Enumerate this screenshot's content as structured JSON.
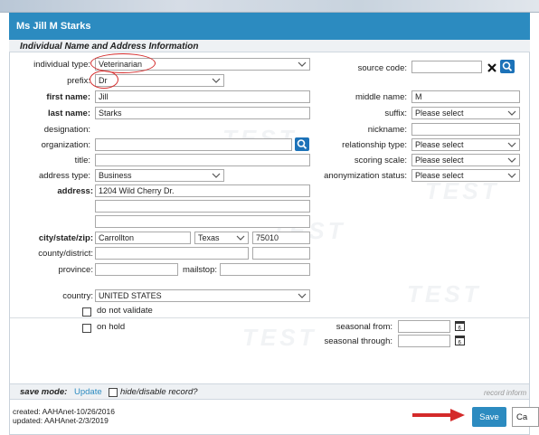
{
  "header": {
    "title": "Ms Jill M Starks"
  },
  "section": {
    "title": "Individual Name and Address Information"
  },
  "labels": {
    "individual_type": "individual type:",
    "prefix": "prefix:",
    "first_name": "first name:",
    "last_name": "last name:",
    "designation": "designation:",
    "organization": "organization:",
    "title": "title:",
    "address_type": "address type:",
    "address": "address:",
    "city_state_zip": "city/state/zip:",
    "county_district": "county/district:",
    "province": "province:",
    "mailstop": "mailstop:",
    "country": "country:",
    "do_not_validate": "do not validate",
    "on_hold": "on hold",
    "source_code": "source code:",
    "middle_name": "middle name:",
    "suffix": "suffix:",
    "nickname": "nickname:",
    "relationship_type": "relationship type:",
    "scoring_scale": "scoring scale:",
    "anonymization_status": "anonymization status:",
    "seasonal_from": "seasonal from:",
    "seasonal_through": "seasonal through:"
  },
  "values": {
    "individual_type": "Veterinarian",
    "prefix": "Dr",
    "first_name": "Jill",
    "last_name": "Starks",
    "address_type": "Business",
    "address_line1": "1204 Wild Cherry Dr.",
    "city": "Carrollton",
    "state": "Texas",
    "zip": "75010",
    "country": "UNITED STATES",
    "middle_name": "M",
    "suffix": "Please select",
    "relationship_type": "Please select",
    "scoring_scale": "Please select",
    "anonymization_status": "Please select"
  },
  "watermark": "TEST",
  "footer": {
    "save_mode_label": "save mode:",
    "save_mode_value": "Update",
    "hide_disable": "hide/disable record?",
    "record_info": "record inform",
    "created": "created: AAHAnet-10/26/2016",
    "updated": "updated: AAHAnet-2/3/2019",
    "save_label": "Save",
    "cancel_label": "Ca"
  },
  "colors": {
    "accent": "#2c8bc0",
    "annotation": "#d42a2a"
  }
}
